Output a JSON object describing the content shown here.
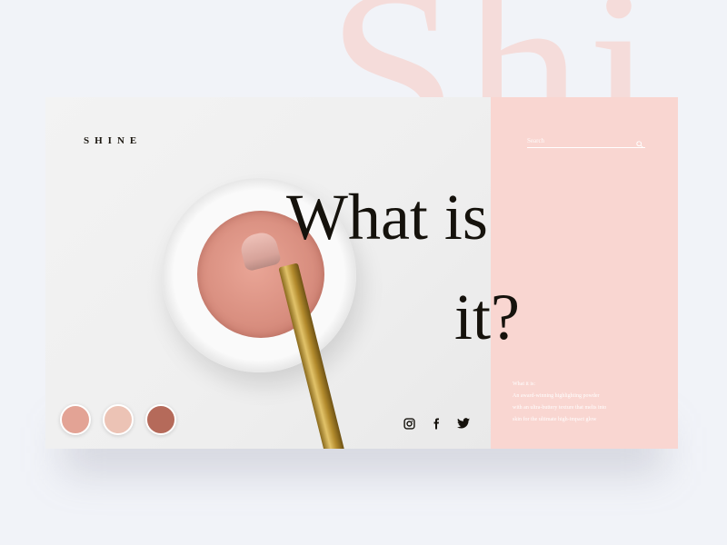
{
  "background_word": "Shi",
  "brand": {
    "logo": "SHINE"
  },
  "hero": {
    "line1": "What is",
    "line2": "it?"
  },
  "search": {
    "placeholder": "Search",
    "icon": "search-icon"
  },
  "description": {
    "title": "What it is:",
    "line1": "An award-winning highlighting powder",
    "line2": "with an ultra-buttery texture that melts into",
    "line3": "skin for the ultimate high-impact glow"
  },
  "swatches": [
    {
      "name": "swatch-rose",
      "color": "#e3a395"
    },
    {
      "name": "swatch-champagne",
      "color": "#ecc3b5"
    },
    {
      "name": "swatch-bronze",
      "color": "#b56a5a"
    }
  ],
  "social": [
    "instagram-icon",
    "facebook-icon",
    "twitter-icon"
  ],
  "colors": {
    "accent_panel": "#f9d6d1",
    "text_dark": "#15120c",
    "background": "#f1f3f8"
  }
}
